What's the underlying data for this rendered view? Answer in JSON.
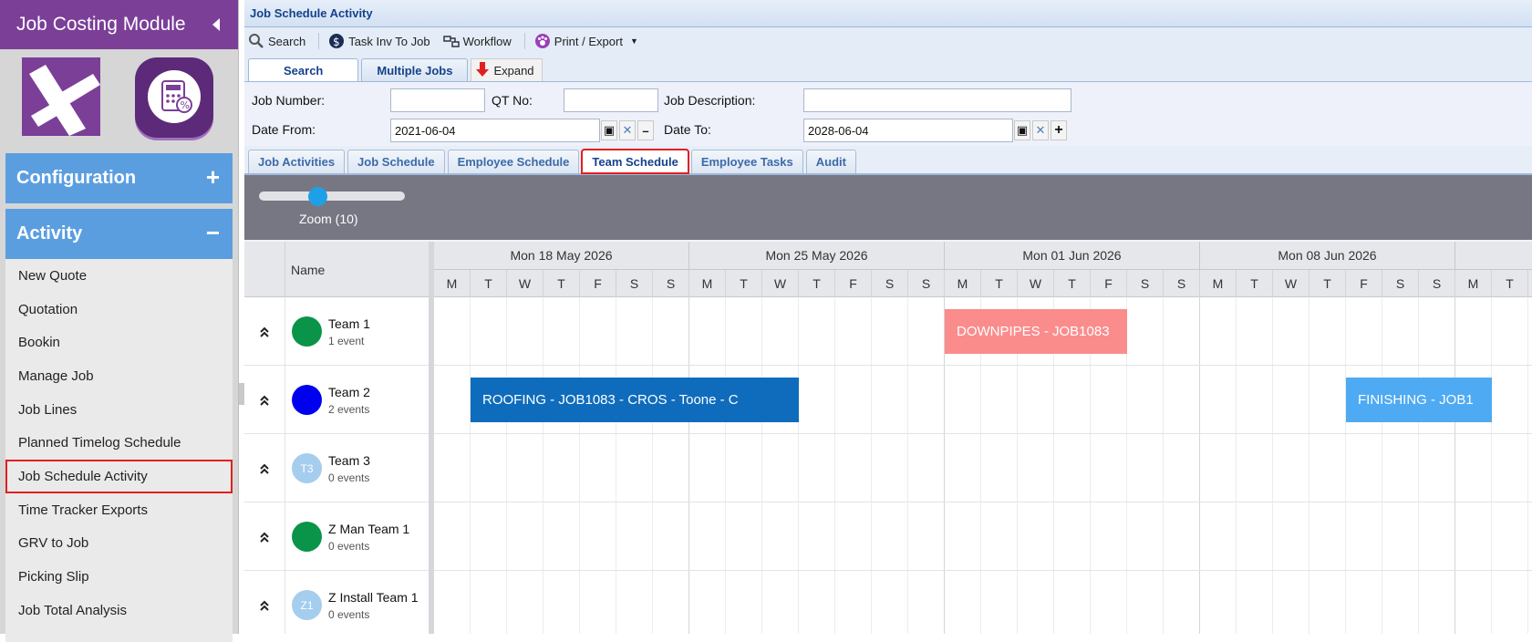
{
  "sidebar": {
    "title": "Job Costing Module",
    "sections": [
      {
        "label": "Configuration",
        "sign": "+"
      },
      {
        "label": "Activity",
        "sign": "−"
      }
    ],
    "items": [
      {
        "label": "New Quote"
      },
      {
        "label": "Quotation"
      },
      {
        "label": "Bookin"
      },
      {
        "label": "Manage Job"
      },
      {
        "label": "Job Lines"
      },
      {
        "label": "Planned Timelog Schedule"
      },
      {
        "label": "Job Schedule Activity"
      },
      {
        "label": "Time Tracker Exports"
      },
      {
        "label": "GRV to Job"
      },
      {
        "label": "Picking Slip"
      },
      {
        "label": "Job Total Analysis"
      }
    ],
    "selected_item": "Job Schedule Activity"
  },
  "page": {
    "title": "Job Schedule Activity"
  },
  "toolbar": {
    "search": "Search",
    "task_inv": "Task Inv To Job",
    "workflow": "Workflow",
    "print_export": "Print / Export"
  },
  "top_tabs": {
    "search": "Search",
    "multiple_jobs": "Multiple Jobs",
    "expand": "Expand"
  },
  "filters": {
    "job_number_label": "Job Number:",
    "job_number_value": "",
    "qt_no_label": "QT No:",
    "qt_no_value": "",
    "job_description_label": "Job Description:",
    "job_description_value": "",
    "date_from_label": "Date From:",
    "date_from_value": "2021-06-04",
    "date_to_label": "Date To:",
    "date_to_value": "2028-06-04"
  },
  "sub_tabs": [
    {
      "label": "Job Activities"
    },
    {
      "label": "Job Schedule"
    },
    {
      "label": "Employee Schedule"
    },
    {
      "label": "Team Schedule"
    },
    {
      "label": "Employee Tasks"
    },
    {
      "label": "Audit"
    }
  ],
  "active_sub_tab": "Team Schedule",
  "scheduler": {
    "zoom_label": "Zoom (10)",
    "zoom_level": 10,
    "name_header": "Name",
    "weeks": [
      "Mon 18 May 2026",
      "Mon 25 May 2026",
      "Mon 01 Jun 2026",
      "Mon 08 Jun 2026",
      ""
    ],
    "day_letters": [
      "M",
      "T",
      "W",
      "T",
      "F",
      "S",
      "S"
    ],
    "resources": [
      {
        "name": "Team 1",
        "events_label": "1 event",
        "avatar_text": "",
        "color": "#0a9449"
      },
      {
        "name": "Team 2",
        "events_label": "2 events",
        "avatar_text": "",
        "color": "#0000f0"
      },
      {
        "name": "Team 3",
        "events_label": "0 events",
        "avatar_text": "T3",
        "color": "#a5cdee"
      },
      {
        "name": "Z Man Team 1",
        "events_label": "0 events",
        "avatar_text": "",
        "color": "#0a9449"
      },
      {
        "name": "Z Install Team 1",
        "events_label": "0 events",
        "avatar_text": "Z1",
        "color": "#a5cdee"
      }
    ],
    "events": [
      {
        "label": "DOWNPIPES - JOB1083",
        "resource": 0,
        "start": "2026-06-01",
        "end": "2026-06-06",
        "color": "#fb8c8c"
      },
      {
        "label": "ROOFING - JOB1083 - CROS - Toone - C",
        "resource": 1,
        "start": "2026-05-19",
        "end": "2026-05-28",
        "color": "#0f6cbd"
      },
      {
        "label": "FINISHING - JOB1",
        "resource": 1,
        "start": "2026-06-12",
        "end": "2026-06-16",
        "color": "#4eaaf2"
      }
    ]
  }
}
